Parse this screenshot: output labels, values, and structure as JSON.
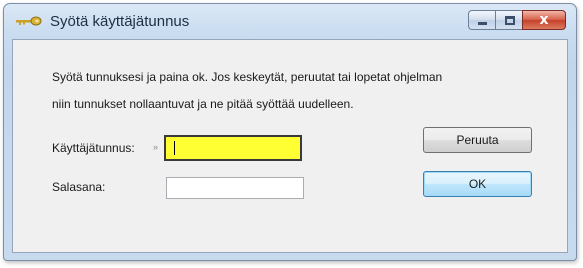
{
  "window": {
    "title": "Syötä käyttäjätunnus",
    "icon": "key-icon",
    "controls": {
      "minimize_icon": "minimize-icon",
      "maximize_icon": "maximize-icon",
      "close_icon": "close-icon",
      "close_glyph": "x"
    }
  },
  "dialog": {
    "message_line1": "Syötä tunnuksesi ja paina ok. Jos keskeytät, peruutat tai lopetat ohjelman",
    "message_line2": "niin tunnukset nollaantuvat ja ne pitää syöttää uudelleen.",
    "username_label": "Käyttäjätunnus:",
    "username_marker": "»",
    "username_value": "",
    "password_label": "Salasana:",
    "password_value": "",
    "cancel_label": "Peruuta",
    "ok_label": "OK"
  },
  "colors": {
    "focused_input_background": "#ffff33",
    "titlebar_gradient_top": "#dbe8f6",
    "close_button_red": "#c5402a"
  }
}
